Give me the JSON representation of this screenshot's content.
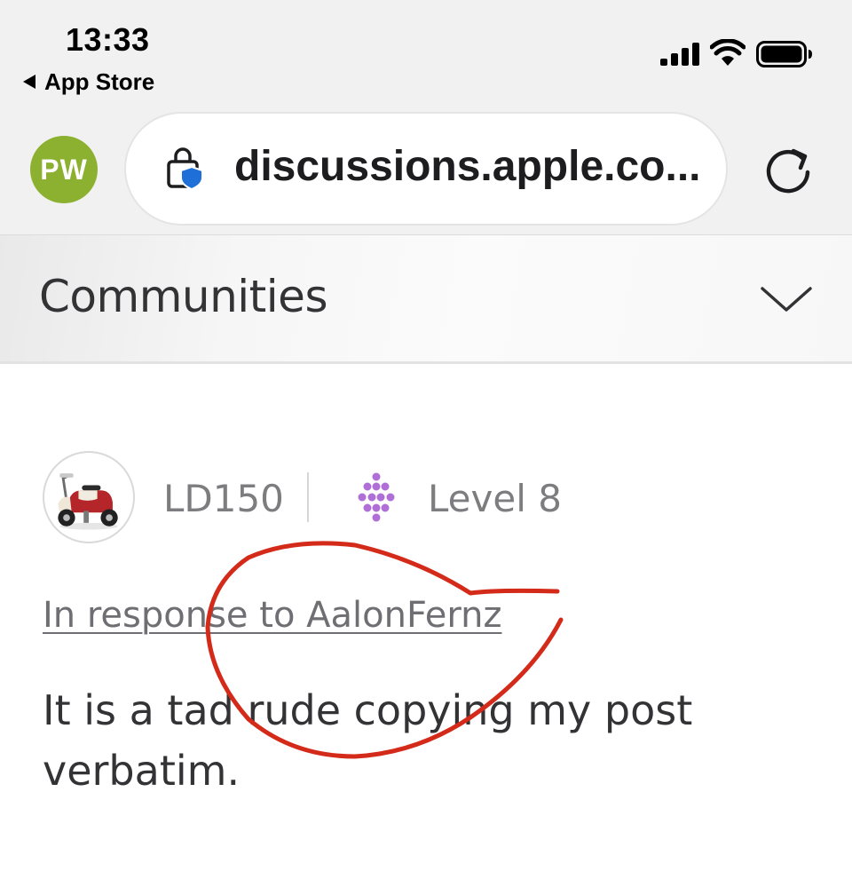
{
  "status_bar": {
    "time": "13:33",
    "back_app_label": "App Store",
    "icons": [
      "cellular-signal-icon",
      "wifi-icon",
      "battery-icon"
    ]
  },
  "browser": {
    "profile_initials": "PW",
    "profile_color": "#8cb02f",
    "url": "discussions.apple.co...",
    "icons": [
      "lock-shield-icon",
      "reload-icon"
    ]
  },
  "communities_header": {
    "title": "Communities",
    "icon": "chevron-down-icon"
  },
  "post": {
    "author": "LD150",
    "level": "Level 8",
    "level_icon_color": "#b06fd6",
    "in_response_to": "In response to AalonFernz",
    "body": "It is a tad rude copying my post verbatim."
  },
  "annotation": {
    "color": "#d42a1a",
    "shape": "hand-drawn-circle"
  }
}
